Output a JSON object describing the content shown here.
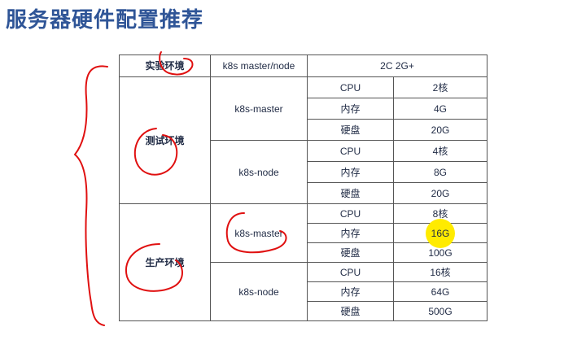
{
  "title": "服务器硬件配置推荐",
  "table": {
    "lab": {
      "label": "实验环境",
      "role": "k8s master/node",
      "spec": "2C 2G+"
    },
    "test": {
      "label": "测试环境",
      "groups": [
        {
          "role": "k8s-master",
          "rows": [
            [
              "CPU",
              "2核"
            ],
            [
              "内存",
              "4G"
            ],
            [
              "硬盘",
              "20G"
            ]
          ]
        },
        {
          "role": "k8s-node",
          "rows": [
            [
              "CPU",
              "4核"
            ],
            [
              "内存",
              "8G"
            ],
            [
              "硬盘",
              "20G"
            ]
          ]
        }
      ]
    },
    "prod": {
      "label": "生产环境",
      "groups": [
        {
          "role": "k8s-master",
          "rows": [
            [
              "CPU",
              "8核"
            ],
            [
              "内存",
              "16G"
            ],
            [
              "硬盘",
              "100G"
            ]
          ]
        },
        {
          "role": "k8s-node",
          "rows": [
            [
              "CPU",
              "16核"
            ],
            [
              "内存",
              "64G"
            ],
            [
              "硬盘",
              "500G"
            ]
          ]
        }
      ]
    }
  },
  "colors": {
    "title": "#2f5597",
    "annotation": "#e01010",
    "highlight": "#ffeb00"
  }
}
